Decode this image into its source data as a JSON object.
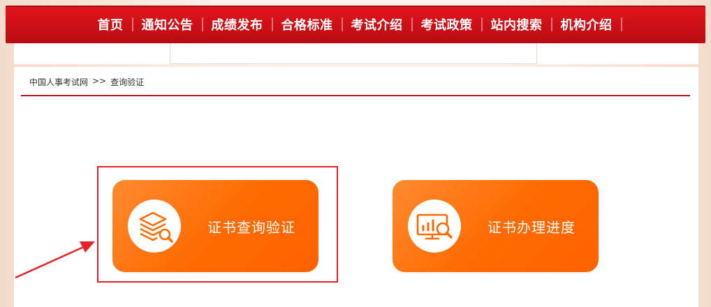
{
  "nav": {
    "items": [
      "首页",
      "通知公告",
      "成绩发布",
      "合格标准",
      "考试介绍",
      "考试政策",
      "站内搜索",
      "机构介绍"
    ],
    "background": "#d11219"
  },
  "breadcrumb": {
    "home": "中国人事考试网",
    "separator": ">>",
    "current": "查询验证"
  },
  "cards": [
    {
      "label": "证书查询验证",
      "icon": "layers-search-icon"
    },
    {
      "label": "证书办理进度",
      "icon": "monitor-chart-search-icon"
    }
  ],
  "colors": {
    "card_orange": "#ff6a00",
    "highlight_red": "#e8202a",
    "divider_red": "#b3161b"
  }
}
